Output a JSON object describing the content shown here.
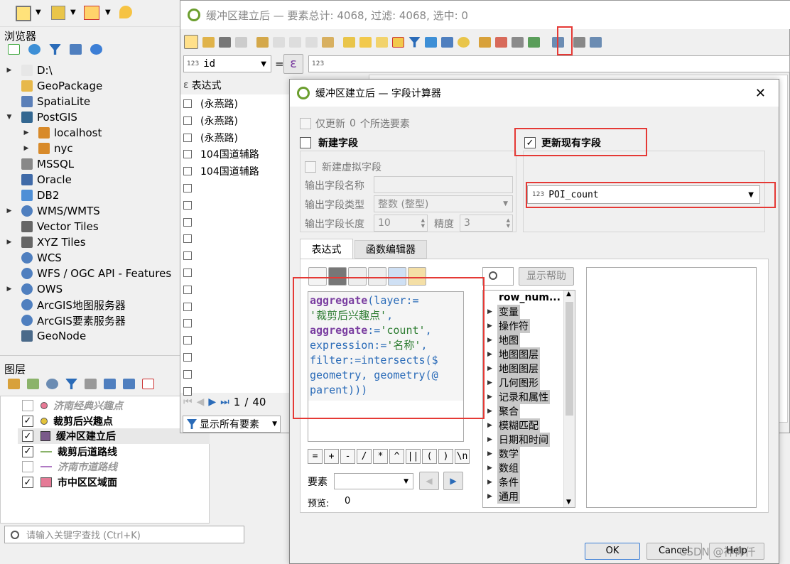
{
  "browser": {
    "title": "浏览器",
    "items": [
      {
        "label": "D:\\",
        "icon": "folder-icon",
        "caret": "▶"
      },
      {
        "label": "GeoPackage",
        "icon": "geopackage-icon",
        "caret": ""
      },
      {
        "label": "SpatiaLite",
        "icon": "spatialite-icon",
        "caret": ""
      },
      {
        "label": "PostGIS",
        "icon": "postgis-icon",
        "caret": "▼"
      },
      {
        "label": "localhost",
        "icon": "connection-icon",
        "caret": "▶"
      },
      {
        "label": "nyc",
        "icon": "connection-icon",
        "caret": "▶"
      },
      {
        "label": "MSSQL",
        "icon": "mssql-icon",
        "caret": ""
      },
      {
        "label": "Oracle",
        "icon": "oracle-icon",
        "caret": ""
      },
      {
        "label": "DB2",
        "icon": "db2-icon",
        "caret": ""
      },
      {
        "label": "WMS/WMTS",
        "icon": "globe-icon",
        "caret": "▶"
      },
      {
        "label": "Vector Tiles",
        "icon": "grid-icon",
        "caret": ""
      },
      {
        "label": "XYZ Tiles",
        "icon": "grid-icon",
        "caret": "▶"
      },
      {
        "label": "WCS",
        "icon": "globe-icon",
        "caret": ""
      },
      {
        "label": "WFS / OGC API - Features",
        "icon": "globe-icon",
        "caret": ""
      },
      {
        "label": "OWS",
        "icon": "globe-icon",
        "caret": "▶"
      },
      {
        "label": "ArcGIS地图服务器",
        "icon": "globe-icon",
        "caret": ""
      },
      {
        "label": "ArcGIS要素服务器",
        "icon": "globe-icon",
        "caret": ""
      },
      {
        "label": "GeoNode",
        "icon": "geonode-icon",
        "caret": ""
      }
    ]
  },
  "layers": {
    "title": "图层",
    "items": [
      {
        "label": "济南经典兴趣点",
        "checked": false,
        "style": "italic-gray",
        "symbol": "pink-dot"
      },
      {
        "label": "裁剪后兴趣点",
        "checked": true,
        "style": "bold",
        "symbol": "yellow-dot"
      },
      {
        "label": "缓冲区建立后",
        "checked": true,
        "style": "bold",
        "symbol": "polygon"
      },
      {
        "label": "裁剪后道路线",
        "checked": true,
        "style": "bold",
        "symbol": "green-line"
      },
      {
        "label": "济南市道路线",
        "checked": false,
        "style": "italic-gray",
        "symbol": "purple-line"
      },
      {
        "label": "市中区区域面",
        "checked": true,
        "style": "bold",
        "symbol": "pink-fill"
      }
    ],
    "search_placeholder": "请输入关键字查找 (Ctrl+K)"
  },
  "attr_table": {
    "title": "缓冲区建立后 — 要素总计: 4068, 过滤: 4068, 选中: 0",
    "field_select": "id",
    "field_type": "123",
    "equals": "=",
    "epsilon": "ε",
    "value_type": "123",
    "expr_header": "表达式",
    "rows": [
      "(永燕路)",
      "(永燕路)",
      "(永燕路)",
      "104国道辅路",
      "104国道辅路"
    ],
    "page_current": "1",
    "page_sep": "/",
    "page_total": "40",
    "show_all": "显示所有要素"
  },
  "dialog": {
    "title": "缓冲区建立后 — 字段计算器",
    "only_update": "仅更新",
    "only_update_count": "0",
    "only_update_suffix": "个所选要素",
    "new_field": "新建字段",
    "update_existing": "更新现有字段",
    "virtual_field": "新建虚拟字段",
    "output_name_label": "输出字段名称",
    "output_type_label": "输出字段类型",
    "output_type_value": "整数 (整型)",
    "output_len_label": "输出字段长度",
    "output_len_value": "10",
    "precision_label": "精度",
    "precision_value": "3",
    "existing_field_type": "123",
    "existing_field": "POI_count",
    "tab_expr": "表达式",
    "tab_func": "函数编辑器",
    "show_help": "显示帮助",
    "func_list": [
      "row_num...",
      "变量",
      "操作符",
      "地图",
      "地图图层",
      "地图图层",
      "几何图形",
      "记录和属性",
      "聚合",
      "模糊匹配",
      "日期和时间",
      "数学",
      "数组",
      "条件",
      "通用"
    ],
    "ops": [
      "=",
      "+",
      "-",
      "/",
      "*",
      "^",
      "||",
      "(",
      ")",
      "\\n"
    ],
    "feature_label": "要素",
    "preview_label": "预览:",
    "preview_value": "0",
    "ok": "OK",
    "cancel": "Cancel",
    "help": "Help"
  },
  "expression_tokens": [
    [
      {
        "t": "aggregate",
        "c": "kw"
      },
      {
        "t": "(layer:=",
        "c": "id"
      }
    ],
    [
      {
        "t": "'裁剪后兴趣点'",
        "c": "str"
      },
      {
        "t": ",",
        "c": "id"
      }
    ],
    [
      {
        "t": "aggregate",
        "c": "kw"
      },
      {
        "t": ":=",
        "c": "id"
      },
      {
        "t": "'count'",
        "c": "str"
      },
      {
        "t": ",",
        "c": "id"
      }
    ],
    [
      {
        "t": "expression:=",
        "c": "id"
      },
      {
        "t": "'名称'",
        "c": "str"
      },
      {
        "t": ",",
        "c": "id"
      }
    ],
    [
      {
        "t": "filter:=intersects($",
        "c": "id"
      }
    ],
    [
      {
        "t": "geometry, geometry(@",
        "c": "id"
      }
    ],
    [
      {
        "t": "parent)))",
        "c": "id"
      }
    ]
  ],
  "watermark": "CSDN @神仰仟",
  "colors": {
    "accent_red": "#e53935",
    "keyword": "#7b3fa1",
    "string": "#2e7d32",
    "identifier": "#2a6bb8"
  }
}
